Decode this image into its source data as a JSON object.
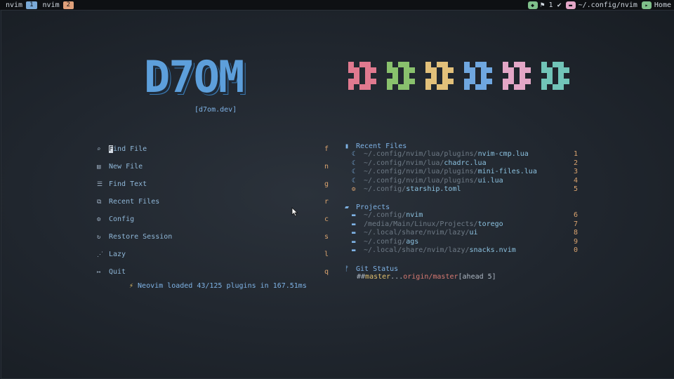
{
  "topbar": {
    "tabs": [
      {
        "label": "nvim",
        "num": "1",
        "color": "#7aa9d6"
      },
      {
        "label": "nvim",
        "num": "2",
        "color": "#e0a07a"
      }
    ],
    "git_status": "⚑ 1 ✔",
    "cwd": "~/.config/nvim",
    "location": "Home"
  },
  "header": {
    "logo": "D7OM",
    "url": "[d7om.dev]",
    "block_colors": [
      "#e0798f",
      "#89c16d",
      "#e2c07a",
      "#6fa7e0",
      "#e3a6c6",
      "#71c4b8"
    ]
  },
  "menu": [
    {
      "icon": "search-icon",
      "glyph": "⌕",
      "label": "Find File",
      "key": "f"
    },
    {
      "icon": "new-file-icon",
      "glyph": "▤",
      "label": "New File",
      "key": "n"
    },
    {
      "icon": "find-text-icon",
      "glyph": "☰",
      "label": "Find Text",
      "key": "g"
    },
    {
      "icon": "recent-files-icon",
      "glyph": "⧉",
      "label": "Recent Files",
      "key": "r"
    },
    {
      "icon": "gear-icon",
      "glyph": "⚙",
      "label": "Config",
      "key": "c"
    },
    {
      "icon": "restore-icon",
      "glyph": "↻",
      "label": "Restore Session",
      "key": "s"
    },
    {
      "icon": "lazy-icon",
      "glyph": "⋰",
      "label": "Lazy",
      "key": "l"
    },
    {
      "icon": "quit-icon",
      "glyph": "↦",
      "label": "Quit",
      "key": "q"
    }
  ],
  "startup": "Neovim loaded 43/125 plugins in 167.51ms",
  "recent_files": {
    "title": "Recent Files",
    "items": [
      {
        "path": "~/.config/nvim/lua/plugins/",
        "name": "nvim-cmp.lua",
        "key": "1",
        "icon": "lua-icon"
      },
      {
        "path": "~/.config/nvim/lua/",
        "name": "chadrc.lua",
        "key": "2",
        "icon": "lua-icon"
      },
      {
        "path": "~/.config/nvim/lua/plugins/",
        "name": "mini-files.lua",
        "key": "3",
        "icon": "lua-icon"
      },
      {
        "path": "~/.config/nvim/lua/plugins/",
        "name": "ui.lua",
        "key": "4",
        "icon": "lua-icon"
      },
      {
        "path": "~/.config/",
        "name": "starship.toml",
        "key": "5",
        "icon": "toml-icon"
      }
    ]
  },
  "projects": {
    "title": "Projects",
    "items": [
      {
        "path": "~/.config/",
        "name": "nvim",
        "key": "6"
      },
      {
        "path": "/media/Main/Linux/Projects/",
        "name": "torego",
        "key": "7"
      },
      {
        "path": "~/.local/share/nvim/lazy/",
        "name": "ui",
        "key": "8"
      },
      {
        "path": "~/.config/",
        "name": "ags",
        "key": "9"
      },
      {
        "path": "~/.local/share/nvim/lazy/",
        "name": "snacks.nvim",
        "key": "0"
      }
    ]
  },
  "git": {
    "title": "Git Status",
    "prefix": "## ",
    "branch": "master",
    "dots": "...",
    "remote": "origin/master",
    "ahead": " [ahead 5]"
  }
}
